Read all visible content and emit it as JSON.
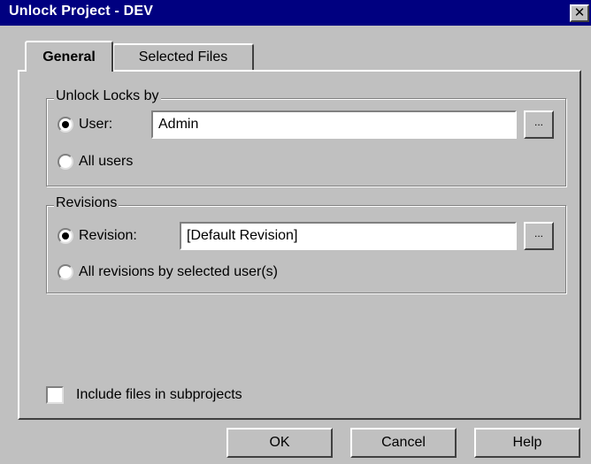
{
  "window": {
    "title": "Unlock Project - DEV",
    "close_glyph": "✕"
  },
  "tabs": [
    {
      "label": "General",
      "active": true
    },
    {
      "label": "Selected Files",
      "active": false
    }
  ],
  "unlock_group": {
    "label": "Unlock Locks by",
    "user_option": {
      "label": "User:",
      "selected": true,
      "value": "Admin",
      "browse_label": "..."
    },
    "all_users_option": {
      "label": "All users",
      "selected": false
    }
  },
  "revisions_group": {
    "label": "Revisions",
    "revision_option": {
      "label": "Revision:",
      "selected": true,
      "value": "[Default Revision]",
      "browse_label": "..."
    },
    "all_revisions_option": {
      "label": "All revisions by selected user(s)",
      "selected": false
    }
  },
  "include_subprojects": {
    "label": "Include files in subprojects",
    "checked": false
  },
  "buttons": {
    "ok": "OK",
    "cancel": "Cancel",
    "help": "Help"
  },
  "colors": {
    "titlebar": "#000080",
    "face": "#c0c0c0"
  }
}
